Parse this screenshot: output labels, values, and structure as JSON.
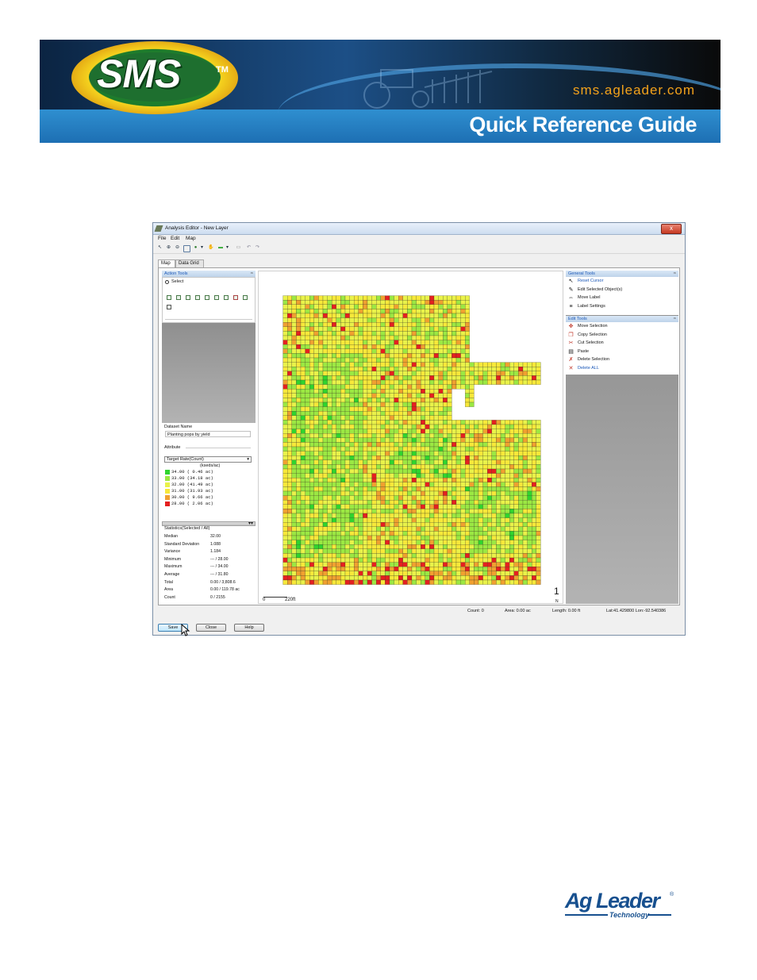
{
  "banner": {
    "logo_text": "SMS",
    "logo_tm": "TM",
    "url": "sms.agleader.com",
    "subtitle": "Quick Reference Guide"
  },
  "window": {
    "title": "Analysis Editor - New Layer",
    "close_glyph": "x"
  },
  "menu": [
    "File",
    "Edit",
    "Map"
  ],
  "tabs": [
    "Map",
    "Data Grid"
  ],
  "action_tools": {
    "header": "Action Tools",
    "select_label": "Select"
  },
  "dataset": {
    "label": "Dataset Name",
    "value": "Planting pops by yield",
    "attribute_label": "Attribute",
    "attribute_value": "Target Rate(Count)",
    "units": "(kseds/ac)"
  },
  "legend": [
    {
      "label": "34.00 ( 0.46 ac)",
      "color": "#2fd42f"
    },
    {
      "label": "33.00 (34.18 ac)",
      "color": "#9be843"
    },
    {
      "label": "32.00 (41.49 ac)",
      "color": "#e9f24a"
    },
    {
      "label": "31.00 (31.93 ac)",
      "color": "#f7e83a"
    },
    {
      "label": "30.00 ( 9.66 ac)",
      "color": "#f0a030"
    },
    {
      "label": "28.00 ( 2.06 ac)",
      "color": "#e42020"
    }
  ],
  "stats": {
    "header": "Statistics(Selected / All)",
    "rows": [
      {
        "k": "Median",
        "v": "32.00"
      },
      {
        "k": "Standard Deviation",
        "v": "1.088"
      },
      {
        "k": "Variance",
        "v": "1.184"
      },
      {
        "k": "Minimum",
        "v": "--- / 28.00"
      },
      {
        "k": "Maximum",
        "v": "--- / 34.00"
      },
      {
        "k": "Average",
        "v": "--- / 31.80"
      },
      {
        "k": "Total",
        "v": "0.00 / 3,808.6"
      },
      {
        "k": "Area",
        "v": "0.00 / 119.78 ac"
      },
      {
        "k": "Count",
        "v": "0 / 2155"
      }
    ]
  },
  "map": {
    "scale_start": "0",
    "scale_end": "220ft",
    "north_glyph": "1",
    "north_letter": "N"
  },
  "general_tools": {
    "header": "General Tools",
    "items": [
      {
        "label": "Reset Cursor",
        "icon": "cursor-icon",
        "glyph": "↖"
      },
      {
        "label": "Edit Selected Object(s)",
        "icon": "edit-icon",
        "glyph": "✎"
      },
      {
        "label": "Move Label",
        "icon": "move-label-icon",
        "glyph": "⇔"
      },
      {
        "label": "Label Settings",
        "icon": "label-settings-icon",
        "glyph": "≡"
      }
    ]
  },
  "edit_tools": {
    "header": "Edit Tools",
    "items": [
      {
        "label": "Move Selection",
        "icon": "move-icon",
        "glyph": "✥"
      },
      {
        "label": "Copy Selection",
        "icon": "copy-icon",
        "glyph": "❐"
      },
      {
        "label": "Cut Selection",
        "icon": "cut-icon",
        "glyph": "✂"
      },
      {
        "label": "Paste",
        "icon": "paste-icon",
        "glyph": "▤"
      },
      {
        "label": "Delete Selection",
        "icon": "delete-selection-icon",
        "glyph": "✗"
      },
      {
        "label": "Delete ALL",
        "icon": "delete-all-icon",
        "glyph": "✕"
      }
    ]
  },
  "status": {
    "count": "Count: 0",
    "area": "Area: 0.00 ac",
    "length": "Length: 0.00 ft",
    "latlon": "Lat:41.429800  Lon:-92.540386"
  },
  "buttons": {
    "save": "Save",
    "close": "Close",
    "help": "Help"
  },
  "aglogo": {
    "name": "Ag Leader",
    "reg": "®",
    "tech": "Technology"
  }
}
